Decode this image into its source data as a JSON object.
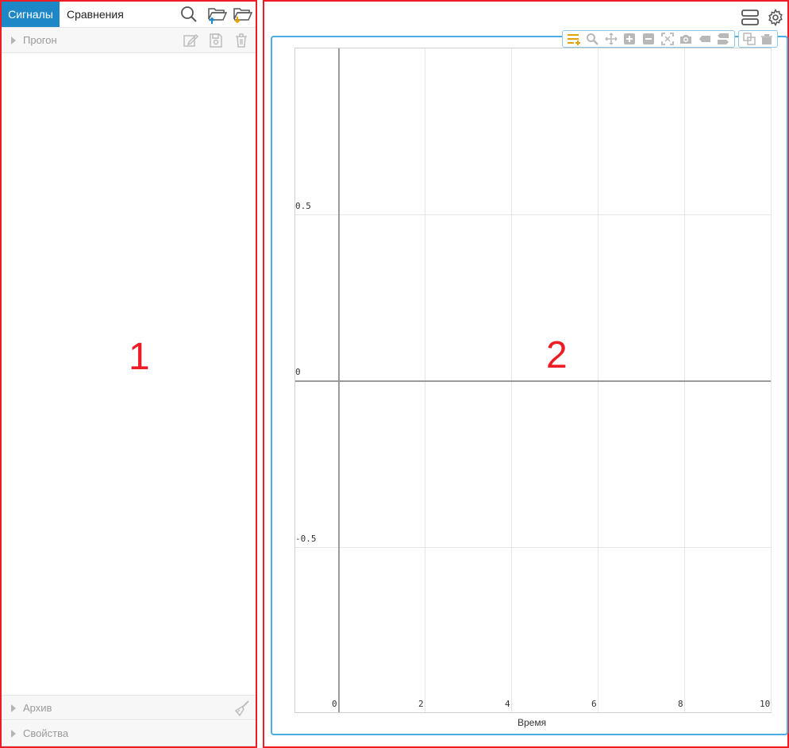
{
  "left_panel": {
    "tabs": [
      {
        "label": "Сигналы",
        "active": true
      },
      {
        "label": "Сравнения",
        "active": false
      }
    ],
    "sections": {
      "run": {
        "label": "Прогон"
      },
      "archive": {
        "label": "Архив"
      },
      "properties": {
        "label": "Свойства"
      }
    },
    "region_number": "1"
  },
  "right_panel": {
    "region_number": "2"
  },
  "chart_data": {
    "type": "line",
    "title": "",
    "xlabel": "Время",
    "ylabel": "",
    "xlim": [
      0,
      10
    ],
    "ylim": [
      -1,
      1
    ],
    "x_ticks": [
      "0",
      "2",
      "4",
      "6",
      "8",
      "10"
    ],
    "y_ticks": [
      "0.5",
      "0",
      "-0.5"
    ],
    "series": [],
    "grid": true
  },
  "icons": {
    "toolbar": [
      "legend-icon",
      "zoom-icon",
      "pan-icon",
      "zoom-in-icon",
      "zoom-out-icon",
      "autoscale-icon",
      "camera-icon",
      "label-icon",
      "toggle-icon",
      "copy-icon",
      "delete-icon"
    ]
  },
  "colors": {
    "accent": "#1e88c7",
    "frame": "#4aaee6",
    "highlight": "#ee1c24",
    "legend_icon": "#e6a100"
  }
}
